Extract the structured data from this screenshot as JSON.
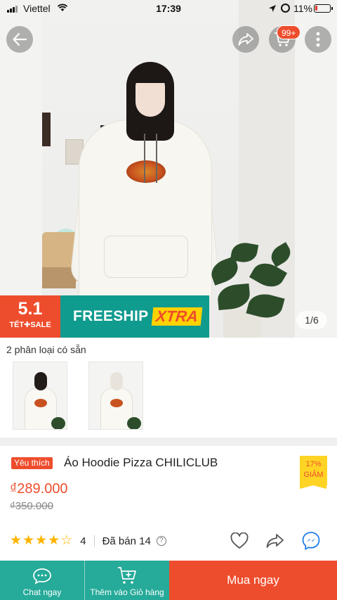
{
  "status_bar": {
    "carrier": "Viettel",
    "time": "17:39",
    "battery": "11%"
  },
  "header": {
    "cart_badge": "99+"
  },
  "gallery": {
    "counter": "1/6"
  },
  "promo": {
    "left_big": "5.1",
    "left_small": "TẾT✚SALE",
    "freeship": "FREESHIP",
    "xtra": "XTRA"
  },
  "variants": {
    "title": "2 phân loại có sẵn",
    "count": 2
  },
  "product": {
    "tag": "Yêu thích",
    "title": "Áo Hoodie Pizza CHILICLUB",
    "price": "₫289.000",
    "old_price": "₫350.000",
    "discount_pct": "17%",
    "discount_label": "GIẢM",
    "rating_value": "4",
    "sold": "Đã bán 14",
    "stars_filled": 4,
    "stars_total": 5
  },
  "bottom_bar": {
    "chat_label": "Chat ngay",
    "cart_label": "Thêm vào Giỏ hàng",
    "buy_label": "Mua ngay"
  },
  "colors": {
    "brand_orange": "#ee4d2d",
    "teal": "#26aa99",
    "star": "#ffb400"
  }
}
